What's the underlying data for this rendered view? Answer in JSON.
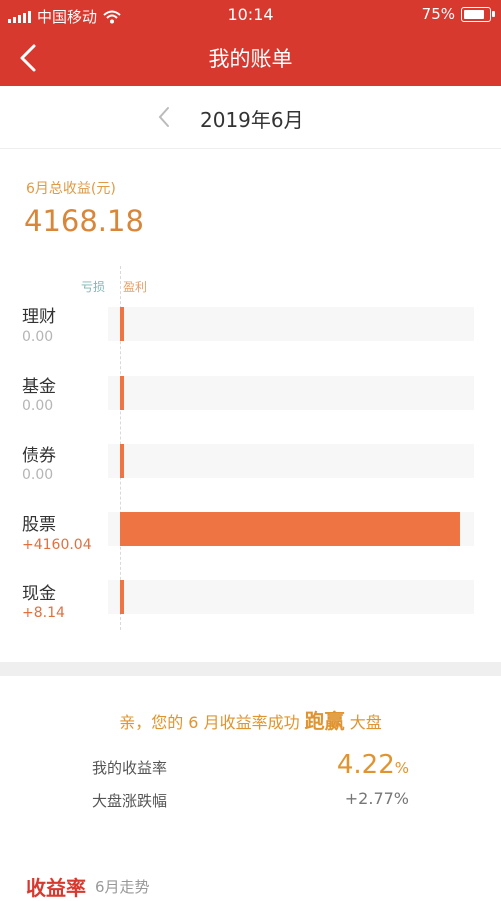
{
  "status": {
    "carrier": "中国移动",
    "time": "10:14",
    "battery": "75%"
  },
  "nav": {
    "title": "我的账单"
  },
  "month": {
    "label": "2019年6月"
  },
  "summary": {
    "label": "6月总收益(元)",
    "value": "4168.18"
  },
  "chart": {
    "legend_loss": "亏损",
    "legend_gain": "盈利",
    "rows": [
      {
        "name": "理财",
        "value": "0.00",
        "amount": 0
      },
      {
        "name": "基金",
        "value": "0.00",
        "amount": 0
      },
      {
        "name": "债券",
        "value": "0.00",
        "amount": 0
      },
      {
        "name": "股票",
        "value": "+4160.04",
        "amount": 4160.04
      },
      {
        "name": "现金",
        "value": "+8.14",
        "amount": 8.14
      }
    ]
  },
  "compare": {
    "prefix": "亲，您的 6 月收益率成功",
    "emphasis": "跑赢",
    "suffix": "大盘",
    "my_label": "我的收益率",
    "my_value": "4.22",
    "my_unit": "%",
    "market_label": "大盘涨跌幅",
    "market_value": "+2.77%"
  },
  "section": {
    "title": "收益率",
    "subtitle": "6月走势"
  }
}
